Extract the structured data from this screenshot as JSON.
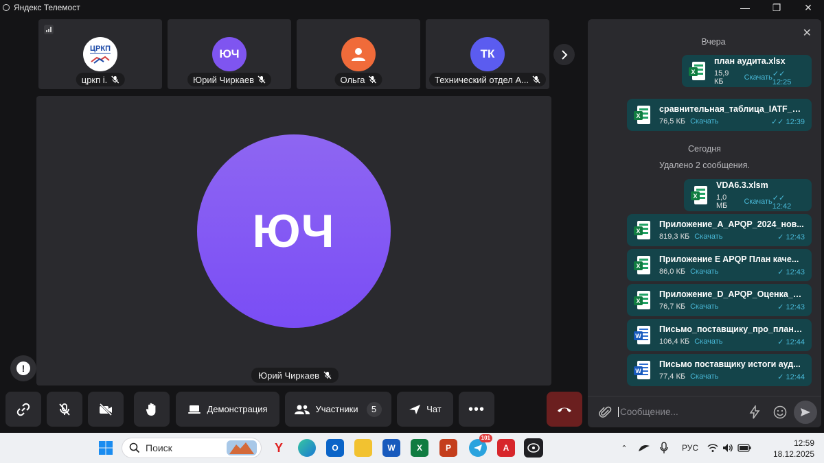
{
  "window": {
    "title": "Яндекс Телемост"
  },
  "tiles": [
    {
      "name": "цркп i.",
      "initials": "",
      "logo_text": "ЦРКП",
      "color": "#ffffff"
    },
    {
      "name": "Юрий Чиркаев",
      "initials": "ЮЧ",
      "color": "#7f55f0"
    },
    {
      "name": "Ольга",
      "initials": "",
      "color": "#f06b3a"
    },
    {
      "name": "Технический отдел А...",
      "initials": "ТК",
      "color": "#5b5cf0"
    }
  ],
  "stage": {
    "initials": "ЮЧ",
    "name": "Юрий Чиркаев"
  },
  "toolbar": {
    "demo_label": "Демонстрация",
    "participants_label": "Участники",
    "participants_count": "5",
    "chat_label": "Чат"
  },
  "chat": {
    "day_yesterday": "Вчера",
    "day_today": "Сегодня",
    "deleted_note": "Удалено 2 сообщения.",
    "download_label": "Скачать",
    "messages": [
      {
        "name": "план аудита.xlsx",
        "size": "15,9 КБ",
        "time": "12:25",
        "type": "excel"
      },
      {
        "name": "сравнительная_таблица_IATF_и_...",
        "size": "76,5 КБ",
        "time": "12:39",
        "type": "excel"
      },
      {
        "name": "VDA6.3.xlsm",
        "size": "1,0 МБ",
        "time": "12:42",
        "type": "excel"
      },
      {
        "name": "Приложение_A_APQP_2024_нов...",
        "size": "819,3 КБ",
        "time": "12:43",
        "type": "excel"
      },
      {
        "name": "Приложение E APQP План каче...",
        "size": "86,0 КБ",
        "time": "12:43",
        "type": "excel"
      },
      {
        "name": "Приложение_D_APQP_Оценка_о...",
        "size": "76,7 КБ",
        "time": "12:43",
        "type": "excel"
      },
      {
        "name": "Письмо_поставщику_про_плани...",
        "size": "106,4 КБ",
        "time": "12:44",
        "type": "word"
      },
      {
        "name": "Письмо поставщику истоги ауд...",
        "size": "77,4 КБ",
        "time": "12:44",
        "type": "word"
      }
    ],
    "input_placeholder": "Сообщение..."
  },
  "taskbar": {
    "search_placeholder": "Поиск",
    "telegram_badge": "101",
    "language": "РУС",
    "time": "12:59",
    "date": "18.12.2025"
  }
}
